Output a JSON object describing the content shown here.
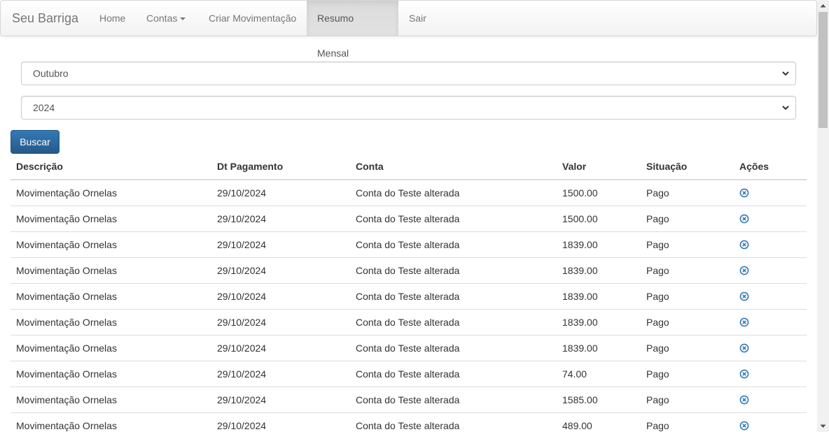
{
  "navbar": {
    "brand": "Seu Barriga",
    "items": [
      {
        "label": "Home"
      },
      {
        "label": "Contas"
      },
      {
        "label": "Criar Movimentação"
      },
      {
        "label": "Resumo Mensal"
      },
      {
        "label": "Sair"
      }
    ]
  },
  "filters": {
    "month": "Outubro",
    "year": "2024",
    "search_button": "Buscar"
  },
  "table": {
    "headers": [
      "Descrição",
      "Dt Pagamento",
      "Conta",
      "Valor",
      "Situação",
      "Ações"
    ],
    "rows": [
      {
        "descricao": "Movimentação Ornelas",
        "data": "29/10/2024",
        "conta": "Conta do Teste alterada",
        "valor": "1500.00",
        "situacao": "Pago"
      },
      {
        "descricao": "Movimentação Ornelas",
        "data": "29/10/2024",
        "conta": "Conta do Teste alterada",
        "valor": "1500.00",
        "situacao": "Pago"
      },
      {
        "descricao": "Movimentação Ornelas",
        "data": "29/10/2024",
        "conta": "Conta do Teste alterada",
        "valor": "1839.00",
        "situacao": "Pago"
      },
      {
        "descricao": "Movimentação Ornelas",
        "data": "29/10/2024",
        "conta": "Conta do Teste alterada",
        "valor": "1839.00",
        "situacao": "Pago"
      },
      {
        "descricao": "Movimentação Ornelas",
        "data": "29/10/2024",
        "conta": "Conta do Teste alterada",
        "valor": "1839.00",
        "situacao": "Pago"
      },
      {
        "descricao": "Movimentação Ornelas",
        "data": "29/10/2024",
        "conta": "Conta do Teste alterada",
        "valor": "1839.00",
        "situacao": "Pago"
      },
      {
        "descricao": "Movimentação Ornelas",
        "data": "29/10/2024",
        "conta": "Conta do Teste alterada",
        "valor": "1839.00",
        "situacao": "Pago"
      },
      {
        "descricao": "Movimentação Ornelas",
        "data": "29/10/2024",
        "conta": "Conta do Teste alterada",
        "valor": "74.00",
        "situacao": "Pago"
      },
      {
        "descricao": "Movimentação Ornelas",
        "data": "29/10/2024",
        "conta": "Conta do Teste alterada",
        "valor": "1585.00",
        "situacao": "Pago"
      },
      {
        "descricao": "Movimentação Ornelas",
        "data": "29/10/2024",
        "conta": "Conta do Teste alterada",
        "valor": "489.00",
        "situacao": "Pago"
      }
    ],
    "action_icon": "remove-circle-icon"
  },
  "colors": {
    "primary": "#337ab7",
    "action_icon": "#337ab7",
    "navbar_text": "#777777"
  }
}
